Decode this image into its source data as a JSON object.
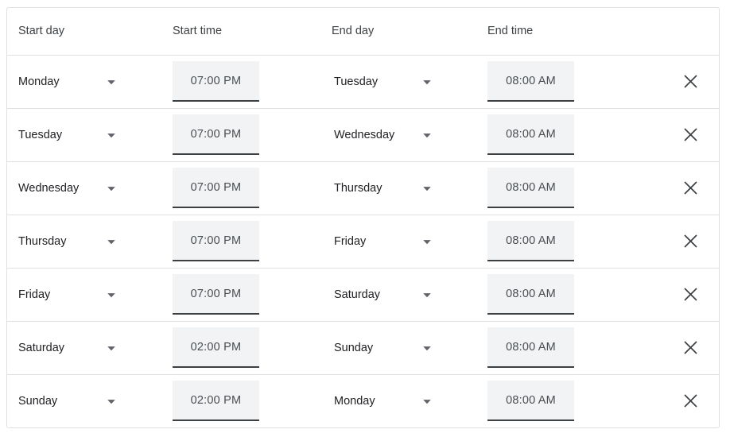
{
  "table": {
    "columns": [
      {
        "key": "start_day",
        "label": "Start day"
      },
      {
        "key": "start_time",
        "label": "Start time"
      },
      {
        "key": "end_day",
        "label": "End day"
      },
      {
        "key": "end_time",
        "label": "End time"
      },
      {
        "key": "remove",
        "label": ""
      }
    ],
    "rows": [
      {
        "start_day": "Monday",
        "start_time": "07:00 PM",
        "end_day": "Tuesday",
        "end_time": "08:00 AM",
        "remove_label": "×"
      },
      {
        "start_day": "Tuesday",
        "start_time": "07:00 PM",
        "end_day": "Wednesday",
        "end_time": "08:00 AM",
        "remove_label": "×"
      },
      {
        "start_day": "Wednesday",
        "start_time": "07:00 PM",
        "end_day": "Thursday",
        "end_time": "08:00 AM",
        "remove_label": "×"
      },
      {
        "start_day": "Thursday",
        "start_time": "07:00 PM",
        "end_day": "Friday",
        "end_time": "08:00 AM",
        "remove_label": "×"
      },
      {
        "start_day": "Friday",
        "start_time": "07:00 PM",
        "end_day": "Saturday",
        "end_time": "08:00 AM",
        "remove_label": "×"
      },
      {
        "start_day": "Saturday",
        "start_time": "02:00 PM",
        "end_day": "Sunday",
        "end_time": "08:00 AM",
        "remove_label": "×"
      },
      {
        "start_day": "Sunday",
        "start_time": "02:00 PM",
        "end_day": "Monday",
        "end_time": "08:00 AM",
        "remove_label": "×"
      }
    ]
  },
  "icons": {
    "dropdown": "chevron-down-icon",
    "remove": "close-icon"
  },
  "colors": {
    "border": "#e0e0e0",
    "field_background": "#f1f3f4",
    "field_underline": "#3c4043",
    "text_primary": "#202124",
    "text_secondary": "#4a4d51",
    "card_background": "#ffffff"
  }
}
